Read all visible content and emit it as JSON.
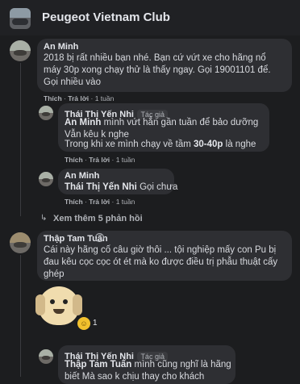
{
  "header": {
    "group_name": "Peugeot Vietnam Club"
  },
  "comments": [
    {
      "author": "An Minh",
      "text": "2018 bị rất nhiều bạn nhé. Bạn cứ vứt xe cho hãng nổ máy 30p xong chạy thử là thấy ngay. Gọi 19001101 để. Gọi nhiều vào",
      "like": "Thích",
      "reply": "Trả lời",
      "time": "1 tuần"
    },
    {
      "author": "Thái Thị Yến Nhi",
      "role": "Tác giả",
      "mention": "An Minh",
      "text": "mình vứt hẳn gần tuần để bảo dưỡng Vẫn kêu k nghe",
      "text2_prefix": "Trong khi xe mình chạy về tầm",
      "text2_bold": "30-40p",
      "text2_suffix": "là nghe",
      "like": "Thích",
      "reply": "Trả lời",
      "time": "1 tuần"
    },
    {
      "author": "An Minh",
      "mention": "Thái Thị Yến Nhi",
      "text": "Gọi chưa",
      "like": "Thích",
      "reply": "Trả lời",
      "time": "1 tuần"
    },
    {
      "more_replies": "Xem thêm 5 phản hồi"
    },
    {
      "author": "Thập Tam Tuấn",
      "text": "Cái này hãng cố câu giờ thôi ... tội nghiệp mấy con Pu bị đau kêu cọc cọc ót ét mà ko được điều trị phẫu thuật cấy ghép",
      "reaction_count": "1"
    },
    {
      "author": "Thái Thị Yến Nhi",
      "role": "Tác giả",
      "mention": "Thập Tam Tuấn",
      "text": "mình cũng nghĩ là hãng biết Mà sao k chịu thay cho khách"
    }
  ]
}
